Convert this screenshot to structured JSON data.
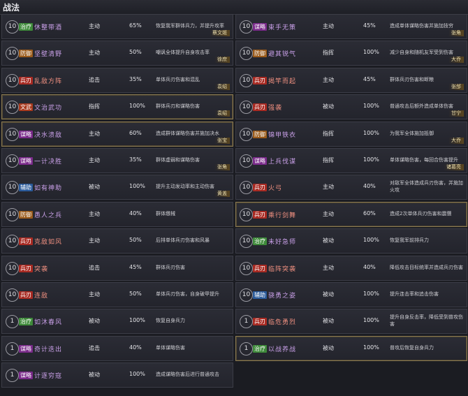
{
  "title": "战法",
  "colors": {
    "治疗": "#3e8a3a",
    "防御": "#9a5a1a",
    "兵刃": "#a82a22",
    "文武": "#a83a1e",
    "谋略": "#7a2a8a",
    "辅助": "#2a5a9a",
    "name_purple": "#c9a0e8",
    "name_red": "#f09080"
  },
  "tactics_left": [
    {
      "level": "10",
      "tag": "治疗",
      "name": "休整带酒",
      "type": "主动",
      "rate": "65%",
      "desc": "恢复我军群体兵力，并提升攻率",
      "hero": "蔡文姬",
      "gold": false
    },
    {
      "level": "10",
      "tag": "防御",
      "name": "坚壁清野",
      "type": "主动",
      "rate": "50%",
      "desc": "嘲讽全体提升自身攻击率",
      "hero": "徐庶",
      "gold": false
    },
    {
      "level": "10",
      "tag": "兵刃",
      "name": "乱敌方阵",
      "type": "追击",
      "rate": "35%",
      "desc": "单体兵刃伤害和混乱",
      "hero": "袁绍",
      "gold": false
    },
    {
      "level": "10",
      "tag": "文武",
      "name": "文治武功",
      "type": "指挥",
      "rate": "100%",
      "desc": "群体兵刃和谋略伤害",
      "hero": "袁绍",
      "gold": true
    },
    {
      "level": "10",
      "tag": "谋略",
      "name": "决水溃敌",
      "type": "主动",
      "rate": "60%",
      "desc": "造成群体谋略伤害并施加决水",
      "hero": "张宝",
      "gold": true
    },
    {
      "level": "10",
      "tag": "谋略",
      "name": "一计决胜",
      "type": "主动",
      "rate": "35%",
      "desc": "群体虚弱和谋略伤害",
      "hero": "张角",
      "gold": false
    },
    {
      "level": "10",
      "tag": "辅助",
      "name": "如有神助",
      "type": "被动",
      "rate": "100%",
      "desc": "提升主动发动率和主动伤害",
      "hero": "黄盖",
      "gold": false
    },
    {
      "level": "10",
      "tag": "防御",
      "name": "愚人之兵",
      "type": "主动",
      "rate": "40%",
      "desc": "群体缴械",
      "hero": "",
      "gold": false
    },
    {
      "level": "10",
      "tag": "兵刃",
      "name": "克敌如风",
      "type": "主动",
      "rate": "50%",
      "desc": "后排单体兵刃伤害和风暴",
      "hero": "",
      "gold": false
    },
    {
      "level": "10",
      "tag": "兵刃",
      "name": "突袭",
      "type": "追击",
      "rate": "45%",
      "desc": "群体兵刃伤害",
      "hero": "",
      "gold": false
    },
    {
      "level": "10",
      "tag": "兵刃",
      "name": "连敌",
      "type": "主动",
      "rate": "50%",
      "desc": "单体兵刃伤害，自身破甲提升",
      "hero": "",
      "gold": false
    },
    {
      "level": "1",
      "tag": "治疗",
      "name": "如沐春风",
      "type": "被动",
      "rate": "100%",
      "desc": "恢复自身兵力",
      "hero": "",
      "gold": false
    },
    {
      "level": "1",
      "tag": "谋略",
      "name": "奇计迭出",
      "type": "追击",
      "rate": "40%",
      "desc": "单体谋略伤害",
      "hero": "",
      "gold": false
    },
    {
      "level": "1",
      "tag": "谋略",
      "name": "计逐穷寇",
      "type": "被动",
      "rate": "100%",
      "desc": "造成谋略伤害后进行普通攻击",
      "hero": "",
      "gold": false
    }
  ],
  "tactics_right": [
    {
      "level": "10",
      "tag": "谋略",
      "name": "束手无策",
      "type": "主动",
      "rate": "45%",
      "desc": "造成单体谋略伤害并施加技穷",
      "hero": "张角",
      "gold": false
    },
    {
      "level": "10",
      "tag": "防御",
      "name": "避其锐气",
      "type": "指挥",
      "rate": "100%",
      "desc": "减少自身和随机友军受到伤害",
      "hero": "大乔",
      "gold": false
    },
    {
      "level": "10",
      "tag": "兵刃",
      "name": "揭竿而起",
      "type": "主动",
      "rate": "45%",
      "desc": "群体兵刃伤害和断粮",
      "hero": "张郃",
      "gold": false
    },
    {
      "level": "10",
      "tag": "兵刃",
      "name": "强袭",
      "type": "被动",
      "rate": "100%",
      "desc": "普通攻击后额外造成单体伤害",
      "hero": "甘宁",
      "gold": false
    },
    {
      "level": "10",
      "tag": "防御",
      "name": "锦甲铁衣",
      "type": "指挥",
      "rate": "100%",
      "desc": "为我军全体施加抵御",
      "hero": "大乔",
      "gold": false
    },
    {
      "level": "10",
      "tag": "谋略",
      "name": "上兵伐谋",
      "type": "指挥",
      "rate": "100%",
      "desc": "单体谋略伤害，每回合伤害提升",
      "hero": "诸葛亮",
      "gold": false
    },
    {
      "level": "10",
      "tag": "兵刃",
      "name": "火弓",
      "type": "主动",
      "rate": "40%",
      "desc": "对敌军全体造成兵刃伤害，并施加火攻",
      "hero": "",
      "gold": false
    },
    {
      "level": "10",
      "tag": "兵刃",
      "name": "乘行剑舞",
      "type": "主动",
      "rate": "60%",
      "desc": "造成2次单体兵刃伤害和震慑",
      "hero": "",
      "gold": true
    },
    {
      "level": "10",
      "tag": "治疗",
      "name": "未好急师",
      "type": "被动",
      "rate": "100%",
      "desc": "恢复我军前排兵力",
      "hero": "",
      "gold": false
    },
    {
      "level": "10",
      "tag": "兵刃",
      "name": "临阵突袭",
      "type": "主动",
      "rate": "40%",
      "desc": "降低攻击目标统率并造成兵刃伤害",
      "hero": "",
      "gold": false
    },
    {
      "level": "10",
      "tag": "辅助",
      "name": "骁勇之姿",
      "type": "被动",
      "rate": "100%",
      "desc": "提升连击率和追击伤害",
      "hero": "",
      "gold": false
    },
    {
      "level": "1",
      "tag": "兵刃",
      "name": "临危勇烈",
      "type": "被动",
      "rate": "100%",
      "desc": "提升自身反击率，降低受到普攻伤害",
      "hero": "",
      "gold": false
    },
    {
      "level": "1",
      "tag": "治疗",
      "name": "以战养战",
      "type": "被动",
      "rate": "100%",
      "desc": "普攻后恢复自身兵力",
      "hero": "",
      "gold": true
    }
  ]
}
